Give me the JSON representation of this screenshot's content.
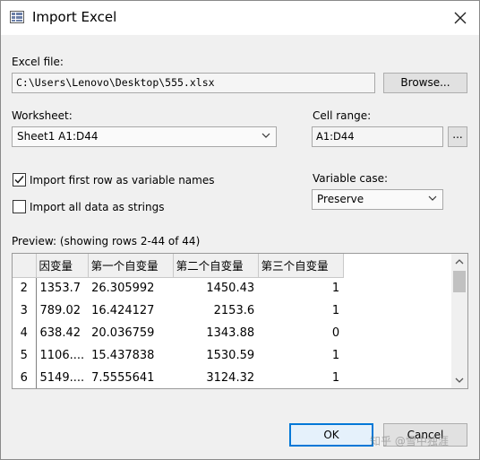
{
  "dialog": {
    "title": "Import Excel",
    "icon": "spreadsheet-icon",
    "close_icon": "close-icon"
  },
  "excel_file": {
    "label": "Excel file:",
    "value": "C:\\Users\\Lenovo\\Desktop\\555.xlsx",
    "browse_label": "Browse..."
  },
  "worksheet": {
    "label": "Worksheet:",
    "selected": "Sheet1 A1:D44"
  },
  "cell_range": {
    "label": "Cell range:",
    "value": "A1:D44",
    "more_label": "..."
  },
  "options": {
    "first_row_label": "Import first row as variable names",
    "first_row_checked": true,
    "strings_label": "Import all data as strings",
    "strings_checked": false
  },
  "variable_case": {
    "label": "Variable case:",
    "selected": "Preserve"
  },
  "preview": {
    "label": "Preview: (showing rows 2-44 of 44)",
    "columns": [
      "因变量",
      "第一个自变量",
      "第二个自变量",
      "第三个自变量"
    ],
    "rows": [
      {
        "n": "2",
        "a": "1353.7",
        "b": "26.305992",
        "c": "1450.43",
        "d": "1"
      },
      {
        "n": "3",
        "a": "789.02",
        "b": "16.424127",
        "c": "2153.6",
        "d": "1"
      },
      {
        "n": "4",
        "a": "638.42",
        "b": "20.036759",
        "c": "1343.88",
        "d": "0"
      },
      {
        "n": "5",
        "a": "1106....",
        "b": "15.437838",
        "c": "1530.59",
        "d": "1"
      },
      {
        "n": "6",
        "a": "5149....",
        "b": "7.5555641",
        "c": "3124.32",
        "d": "1"
      }
    ]
  },
  "buttons": {
    "ok": "OK",
    "cancel": "Cancel"
  },
  "watermark": "知乎 @雪中独涯"
}
